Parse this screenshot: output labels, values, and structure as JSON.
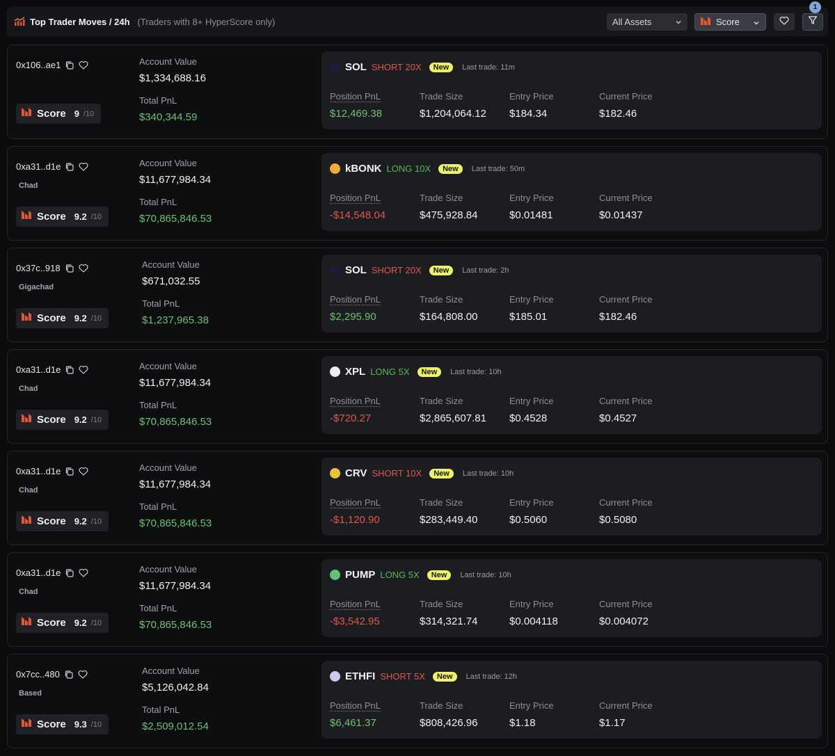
{
  "header": {
    "title": "Top Trader Moves / 24h",
    "subtitle": "(Traders with 8+ HyperScore only)",
    "assets_select": "All Assets",
    "score_select": "Score",
    "filter_count": "1",
    "icons": [
      "chart-icon",
      "chevron-down-icon",
      "heart-icon",
      "filter-icon"
    ]
  },
  "rows": [
    {
      "address": "0x106..ae1",
      "tag": "",
      "score_label": "Score",
      "score": "9",
      "score_max": "/10",
      "account_value_label": "Account Value",
      "account_value": "$1,334,688.16",
      "total_pnl_label": "Total PnL",
      "total_pnl": "$340,344.59",
      "position": {
        "symbol": "SOL",
        "side": "SHORT 20X",
        "side_type": "short",
        "new_label": "New",
        "last_trade": "Last trade: 11m",
        "coin_color": "#1b1d3a",
        "pnl_label": "Position PnL",
        "pnl": "$12,469.38",
        "pnl_sign": "positive",
        "size_label": "Trade Size",
        "size": "$1,204,064.12",
        "entry_label": "Entry Price",
        "entry": "$184.34",
        "current_label": "Current Price",
        "current": "$182.46"
      }
    },
    {
      "address": "0xa31..d1e",
      "tag": "Chad",
      "score_label": "Score",
      "score": "9.2",
      "score_max": "/10",
      "account_value_label": "Account Value",
      "account_value": "$11,677,984.34",
      "total_pnl_label": "Total PnL",
      "total_pnl": "$70,865,846.53",
      "position": {
        "symbol": "kBONK",
        "side": "LONG 10X",
        "side_type": "long",
        "new_label": "New",
        "last_trade": "Last trade: 50m",
        "coin_color": "#f2a93b",
        "pnl_label": "Position PnL",
        "pnl": "-$14,548.04",
        "pnl_sign": "negative",
        "size_label": "Trade Size",
        "size": "$475,928.84",
        "entry_label": "Entry Price",
        "entry": "$0.01481",
        "current_label": "Current Price",
        "current": "$0.01437"
      }
    },
    {
      "address": "0x37c..918",
      "tag": "Gigachad",
      "score_label": "Score",
      "score": "9.2",
      "score_max": "/10",
      "account_value_label": "Account Value",
      "account_value": "$671,032.55",
      "total_pnl_label": "Total PnL",
      "total_pnl": "$1,237,965.38",
      "position": {
        "symbol": "SOL",
        "side": "SHORT 20X",
        "side_type": "short",
        "new_label": "New",
        "last_trade": "Last trade: 2h",
        "coin_color": "#1b1d3a",
        "pnl_label": "Position PnL",
        "pnl": "$2,295.90",
        "pnl_sign": "positive",
        "size_label": "Trade Size",
        "size": "$164,808.00",
        "entry_label": "Entry Price",
        "entry": "$185.01",
        "current_label": "Current Price",
        "current": "$182.46"
      }
    },
    {
      "address": "0xa31..d1e",
      "tag": "Chad",
      "score_label": "Score",
      "score": "9.2",
      "score_max": "/10",
      "account_value_label": "Account Value",
      "account_value": "$11,677,984.34",
      "total_pnl_label": "Total PnL",
      "total_pnl": "$70,865,846.53",
      "position": {
        "symbol": "XPL",
        "side": "LONG 5X",
        "side_type": "long",
        "new_label": "New",
        "last_trade": "Last trade: 10h",
        "coin_color": "#eceef2",
        "pnl_label": "Position PnL",
        "pnl": "-$720.27",
        "pnl_sign": "negative",
        "size_label": "Trade Size",
        "size": "$2,865,607.81",
        "entry_label": "Entry Price",
        "entry": "$0.4528",
        "current_label": "Current Price",
        "current": "$0.4527"
      }
    },
    {
      "address": "0xa31..d1e",
      "tag": "Chad",
      "score_label": "Score",
      "score": "9.2",
      "score_max": "/10",
      "account_value_label": "Account Value",
      "account_value": "$11,677,984.34",
      "total_pnl_label": "Total PnL",
      "total_pnl": "$70,865,846.53",
      "position": {
        "symbol": "CRV",
        "side": "SHORT 10X",
        "side_type": "short",
        "new_label": "New",
        "last_trade": "Last trade: 10h",
        "coin_color": "#e9c23b",
        "pnl_label": "Position PnL",
        "pnl": "-$1,120.90",
        "pnl_sign": "negative",
        "size_label": "Trade Size",
        "size": "$283,449.40",
        "entry_label": "Entry Price",
        "entry": "$0.5060",
        "current_label": "Current Price",
        "current": "$0.5080"
      }
    },
    {
      "address": "0xa31..d1e",
      "tag": "Chad",
      "score_label": "Score",
      "score": "9.2",
      "score_max": "/10",
      "account_value_label": "Account Value",
      "account_value": "$11,677,984.34",
      "total_pnl_label": "Total PnL",
      "total_pnl": "$70,865,846.53",
      "position": {
        "symbol": "PUMP",
        "side": "LONG 5X",
        "side_type": "long",
        "new_label": "New",
        "last_trade": "Last trade: 10h",
        "coin_color": "#5fc07a",
        "pnl_label": "Position PnL",
        "pnl": "-$3,542.95",
        "pnl_sign": "negative",
        "size_label": "Trade Size",
        "size": "$314,321.74",
        "entry_label": "Entry Price",
        "entry": "$0.004118",
        "current_label": "Current Price",
        "current": "$0.004072"
      }
    },
    {
      "address": "0x7cc..480",
      "tag": "Based",
      "score_label": "Score",
      "score": "9.3",
      "score_max": "/10",
      "account_value_label": "Account Value",
      "account_value": "$5,126,042.84",
      "total_pnl_label": "Total PnL",
      "total_pnl": "$2,509,012.54",
      "position": {
        "symbol": "ETHFI",
        "side": "SHORT 5X",
        "side_type": "short",
        "new_label": "New",
        "last_trade": "Last trade: 12h",
        "coin_color": "#c9ccef",
        "pnl_label": "Position PnL",
        "pnl": "$6,461.37",
        "pnl_sign": "positive",
        "size_label": "Trade Size",
        "size": "$808,426.96",
        "entry_label": "Entry Price",
        "entry": "$1.18",
        "current_label": "Current Price",
        "current": "$1.17"
      }
    }
  ]
}
